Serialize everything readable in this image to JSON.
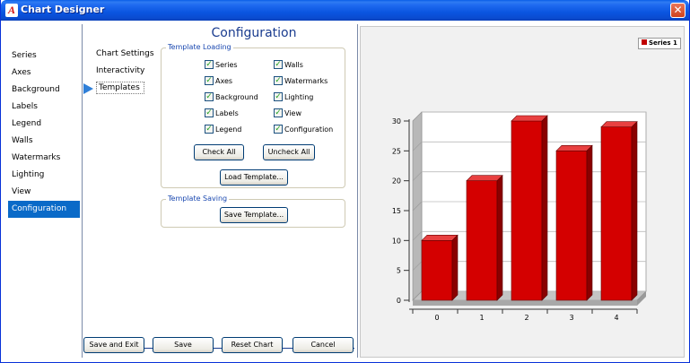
{
  "window": {
    "title": "Chart Designer",
    "icon_letter": "A",
    "close_glyph": "✕"
  },
  "nav": {
    "items": [
      {
        "label": "Series"
      },
      {
        "label": "Axes"
      },
      {
        "label": "Background"
      },
      {
        "label": "Labels"
      },
      {
        "label": "Legend"
      },
      {
        "label": "Walls"
      },
      {
        "label": "Watermarks"
      },
      {
        "label": "Lighting"
      },
      {
        "label": "View"
      },
      {
        "label": "Configuration"
      }
    ],
    "selected": "Configuration"
  },
  "subnav": {
    "items": [
      {
        "label": "Chart Settings"
      },
      {
        "label": "Interactivity"
      },
      {
        "label": "Templates"
      }
    ],
    "selected": "Templates"
  },
  "config": {
    "title": "Configuration",
    "template_loading": {
      "legend": "Template Loading",
      "left_checks": [
        {
          "label": "Series",
          "checked": true
        },
        {
          "label": "Axes",
          "checked": true
        },
        {
          "label": "Background",
          "checked": true
        },
        {
          "label": "Labels",
          "checked": true
        },
        {
          "label": "Legend",
          "checked": true
        }
      ],
      "right_checks": [
        {
          "label": "Walls",
          "checked": true
        },
        {
          "label": "Watermarks",
          "checked": true
        },
        {
          "label": "Lighting",
          "checked": true
        },
        {
          "label": "View",
          "checked": true
        },
        {
          "label": "Configuration",
          "checked": true
        }
      ],
      "check_mark": "✓",
      "check_all": "Check All",
      "uncheck_all": "Uncheck All",
      "load_template": "Load Template..."
    },
    "template_saving": {
      "legend": "Template Saving",
      "save_template": "Save Template..."
    }
  },
  "footer": {
    "save_and_exit": "Save and Exit",
    "save": "Save",
    "reset_chart": "Reset Chart",
    "cancel": "Cancel"
  },
  "colors": {
    "bar": "#d40000",
    "bar_top": "#e84040",
    "bar_side": "#8a0000",
    "selected_nav": "#0a6ac8",
    "accent_title": "#1a3c8f"
  },
  "chart_data": {
    "type": "bar",
    "categories": [
      "0",
      "1",
      "2",
      "3",
      "4"
    ],
    "series": [
      {
        "name": "Series 1",
        "values": [
          10,
          20,
          30,
          25,
          29
        ]
      }
    ],
    "y_ticks": [
      "0",
      "5",
      "10",
      "15",
      "20",
      "25",
      "30"
    ],
    "ylim": [
      0,
      30
    ],
    "grid": true,
    "legend_position": "top-right"
  }
}
